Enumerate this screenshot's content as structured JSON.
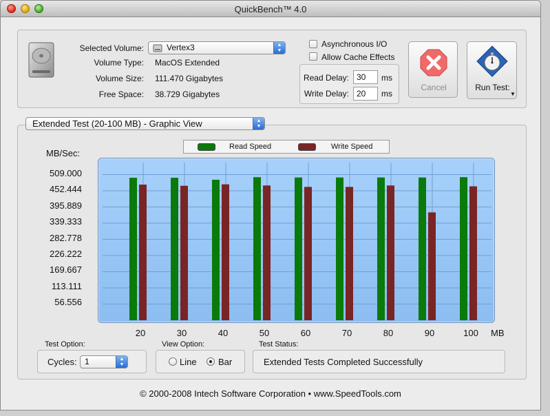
{
  "window": {
    "title": "QuickBench™ 4.0"
  },
  "volume": {
    "selected_label": "Selected Volume:",
    "selected_value": "Vertex3",
    "type_label": "Volume Type:",
    "type_value": "MacOS Extended",
    "size_label": "Volume Size:",
    "size_value": "111.470 Gigabytes",
    "free_label": "Free Space:",
    "free_value": "38.729 Gigabytes"
  },
  "options": {
    "async_label": "Asynchronous I/O",
    "cache_label": "Allow Cache Effects",
    "read_delay_label": "Read Delay:",
    "read_delay_value": "30",
    "write_delay_label": "Write Delay:",
    "write_delay_value": "20",
    "unit": "ms"
  },
  "buttons": {
    "cancel_label": "Cancel",
    "run_label": "Run Test:"
  },
  "test_select": {
    "value": "Extended Test (20-100 MB) - Graphic View"
  },
  "chart_data": {
    "type": "bar",
    "ylabel": "MB/Sec:",
    "xlabel": "MB",
    "categories": [
      "20",
      "30",
      "40",
      "50",
      "60",
      "70",
      "80",
      "90",
      "100"
    ],
    "y_ticks": [
      "509.000",
      "452.444",
      "395.889",
      "339.333",
      "282.778",
      "226.222",
      "169.667",
      "113.111",
      "56.556"
    ],
    "ylim": [
      0,
      565.556
    ],
    "series": [
      {
        "name": "Read Speed",
        "color": "#0a7a0a",
        "values": [
          498,
          498,
          491,
          500,
          499,
          499,
          499,
          499,
          500
        ]
      },
      {
        "name": "Write Speed",
        "color": "#7a2525",
        "values": [
          474,
          470,
          475,
          471,
          466,
          466,
          471,
          377,
          468
        ]
      }
    ]
  },
  "bottom": {
    "test_option_label": "Test Option:",
    "cycles_label": "Cycles:",
    "cycles_value": "1",
    "view_option_label": "View Option:",
    "line_label": "Line",
    "bar_label": "Bar",
    "status_label": "Test Status:",
    "status_value": "Extended Tests Completed Successfully"
  },
  "footer": {
    "text": "© 2000-2008 Intech Software Corporation • www.SpeedTools.com"
  }
}
